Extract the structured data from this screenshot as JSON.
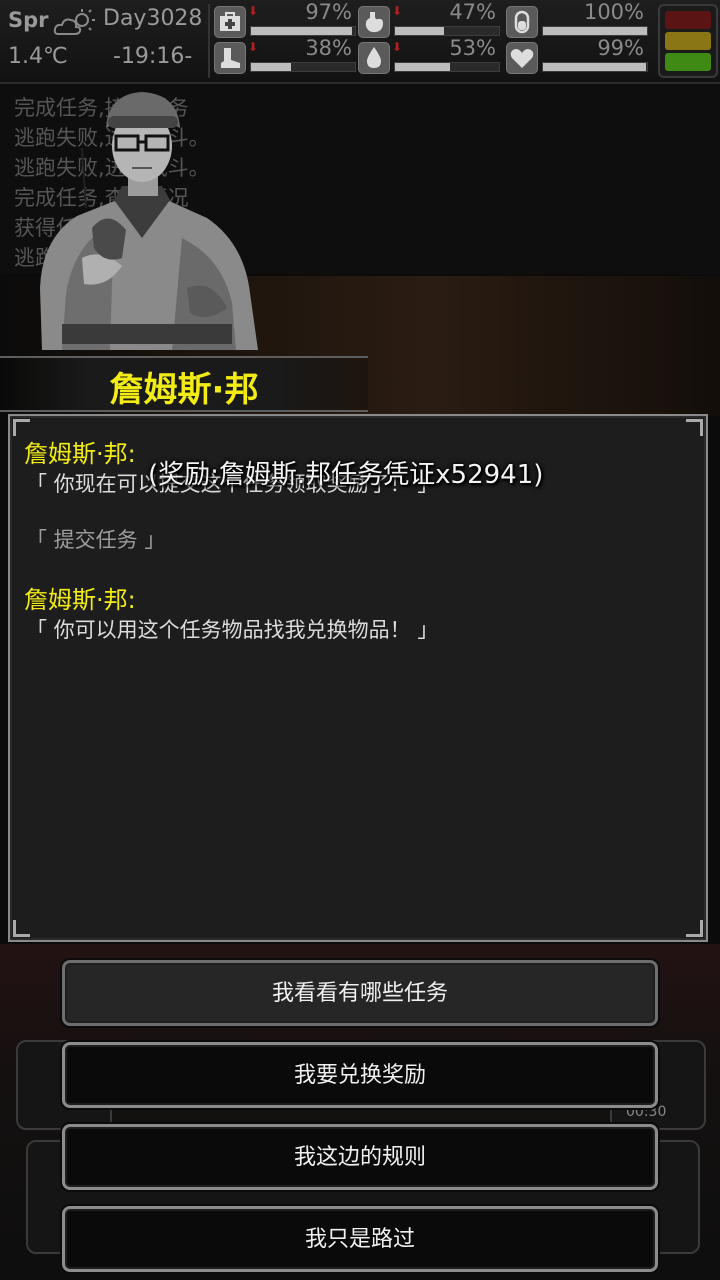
{
  "status": {
    "season": "Spr",
    "temperature": "1.4℃",
    "day": "Day3028",
    "time": "-19:16-",
    "stats": [
      {
        "icon": "medkit-icon",
        "value": "97%",
        "level": 0.97
      },
      {
        "icon": "stomach-icon",
        "value": "47%",
        "level": 0.47
      },
      {
        "icon": "bladder-icon",
        "value": "100%",
        "level": 1.0
      },
      {
        "icon": "boot-icon",
        "value": "38%",
        "level": 0.38
      },
      {
        "icon": "water-drop-icon",
        "value": "53%",
        "level": 0.53
      },
      {
        "icon": "heart-icon",
        "value": "99%",
        "level": 0.99
      }
    ],
    "down_arrow": "⬇",
    "alert_colors": {
      "red": "#5a1414",
      "yellow": "#8a7614",
      "green": "#3f8a14"
    }
  },
  "log": {
    "lines": [
      "完成任务,接受任务",
      "逃跑失败,进入战斗。",
      "逃跑失败,进入战斗。",
      "完成任务,查看情况",
      "获得任务物品",
      "逃跑"
    ]
  },
  "npc": {
    "name": "詹姆斯·邦"
  },
  "dialog": {
    "speaker_1": "詹姆斯·邦:",
    "line_1": "「 你现在可以提交这个任务领取奖励了！ 」",
    "player_line": "「 提交任务 」",
    "speaker_2": "詹姆斯·邦:",
    "line_2": "「 你可以用这个任务物品找我兑换物品！ 」",
    "reward_toast": "(奖励:詹姆斯.邦任务凭证x52941)"
  },
  "hud": {
    "timer": "00:30"
  },
  "options": [
    {
      "label": "我看看有哪些任务"
    },
    {
      "label": "我要兑换奖励"
    },
    {
      "label": "我这边的规则"
    },
    {
      "label": "我只是路过"
    }
  ]
}
